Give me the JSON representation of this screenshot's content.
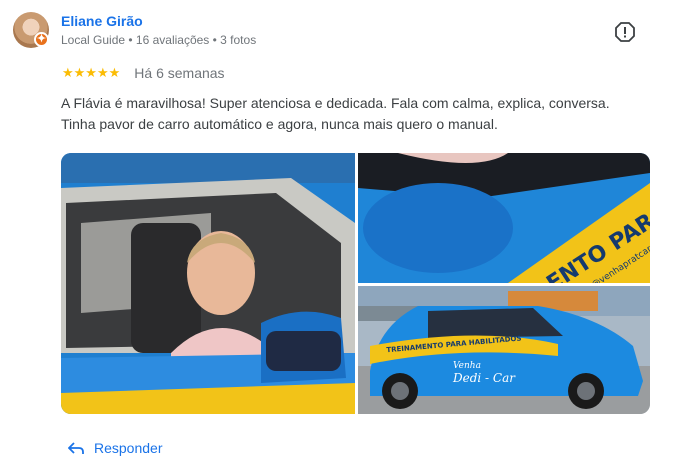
{
  "review": {
    "author": "Eliane Girão",
    "author_meta": "Local Guide • 16 avaliações • 3 fotos",
    "rating": 5,
    "stars": "★★★★★",
    "date": "Há 6 semanas",
    "text_line1": "A Flávia é maravilhosa! Super atenciosa e dedicada. Fala com calma, explica, conversa.",
    "text_line2": "Tinha pavor de carro automático e agora, nunca mais quero o manual."
  },
  "photo_text": {
    "door_lettering": "ENTO PARA",
    "door_handle": "@venhapratcar",
    "car_banner": "TREINAMENTO PARA HABILITADOS",
    "brand_top": "Venha",
    "brand_bottom": "Dedi - Car"
  },
  "actions": {
    "reply_label": "Responder"
  },
  "colors": {
    "link": "#1a73e8",
    "star": "#fbbc04",
    "car_blue": "#1e88d8",
    "car_yellow": "#f2c318"
  },
  "icons": {
    "more": "report-flag-icon",
    "reply": "reply-arrow-icon",
    "local_guide": "local-guide-badge-icon"
  }
}
